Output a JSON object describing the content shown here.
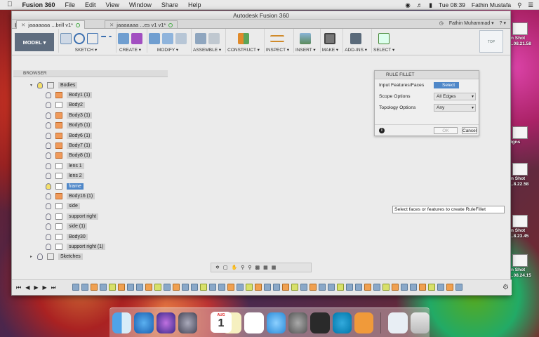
{
  "menubar": {
    "apple": "",
    "app": "Fusion 360",
    "items": [
      "File",
      "Edit",
      "View",
      "Window",
      "Share",
      "Help"
    ],
    "clock": "Tue 08:39",
    "user": "Fathin Mustafa"
  },
  "window": {
    "title": "Autodesk Fusion 360"
  },
  "tabs": [
    {
      "label": "jaaaaaaa ...brill v1*"
    },
    {
      "label": "jaaaaaaa ...es v1 v1*"
    }
  ],
  "userbar": {
    "name": "Fathin Muhammad ▾",
    "help": "? ▾"
  },
  "ribbon": {
    "model": "MODEL ▾",
    "groups": [
      "SKETCH ▾",
      "CREATE ▾",
      "MODIFY ▾",
      "ASSEMBLE ▾",
      "CONSTRUCT ▾",
      "INSPECT ▾",
      "INSERT ▾",
      "MAKE ▾",
      "ADD-INS ▾",
      "SELECT ▾"
    ],
    "viewcube": "TOP"
  },
  "browser": {
    "title": "BROWSER",
    "bodies_label": "Bodies",
    "sketches_label": "Sketches",
    "items": [
      {
        "label": "Body1 (1)",
        "type": "body"
      },
      {
        "label": "Body2",
        "type": "plain"
      },
      {
        "label": "Body3 (1)",
        "type": "body"
      },
      {
        "label": "Body5 (1)",
        "type": "body"
      },
      {
        "label": "Body6 (1)",
        "type": "body"
      },
      {
        "label": "Body7 (1)",
        "type": "body"
      },
      {
        "label": "Body8 (1)",
        "type": "body"
      },
      {
        "label": "lens 1",
        "type": "plain"
      },
      {
        "label": "lens 2",
        "type": "plain"
      },
      {
        "label": "frame",
        "type": "plain",
        "selected": true
      },
      {
        "label": "Body16 (1)",
        "type": "body"
      },
      {
        "label": "side",
        "type": "plain"
      },
      {
        "label": "support right",
        "type": "plain"
      },
      {
        "label": "side (1)",
        "type": "plain"
      },
      {
        "label": "Body30",
        "type": "plain"
      },
      {
        "label": "support right (1)",
        "type": "plain"
      }
    ]
  },
  "dialog": {
    "title": "RULE FILLET",
    "input_label": "Input Features/Faces",
    "select_btn": "Select",
    "scope_label": "Scope Options",
    "scope_value": "All Edges",
    "topology_label": "Topology Options",
    "topology_value": "Any",
    "ok": "OK",
    "cancel": "Cancel",
    "info": "i"
  },
  "tooltip": "Select faces or features to create RuleFillet",
  "desktop": [
    "n Shot",
    "..08.21.58",
    "igns",
    "n Shot",
    "..8.22.58",
    "n Shot",
    "..8.23.45",
    "n Shot",
    "..08.24.15"
  ],
  "dock": {
    "calendar_month": "AUG",
    "calendar_day": "1"
  }
}
